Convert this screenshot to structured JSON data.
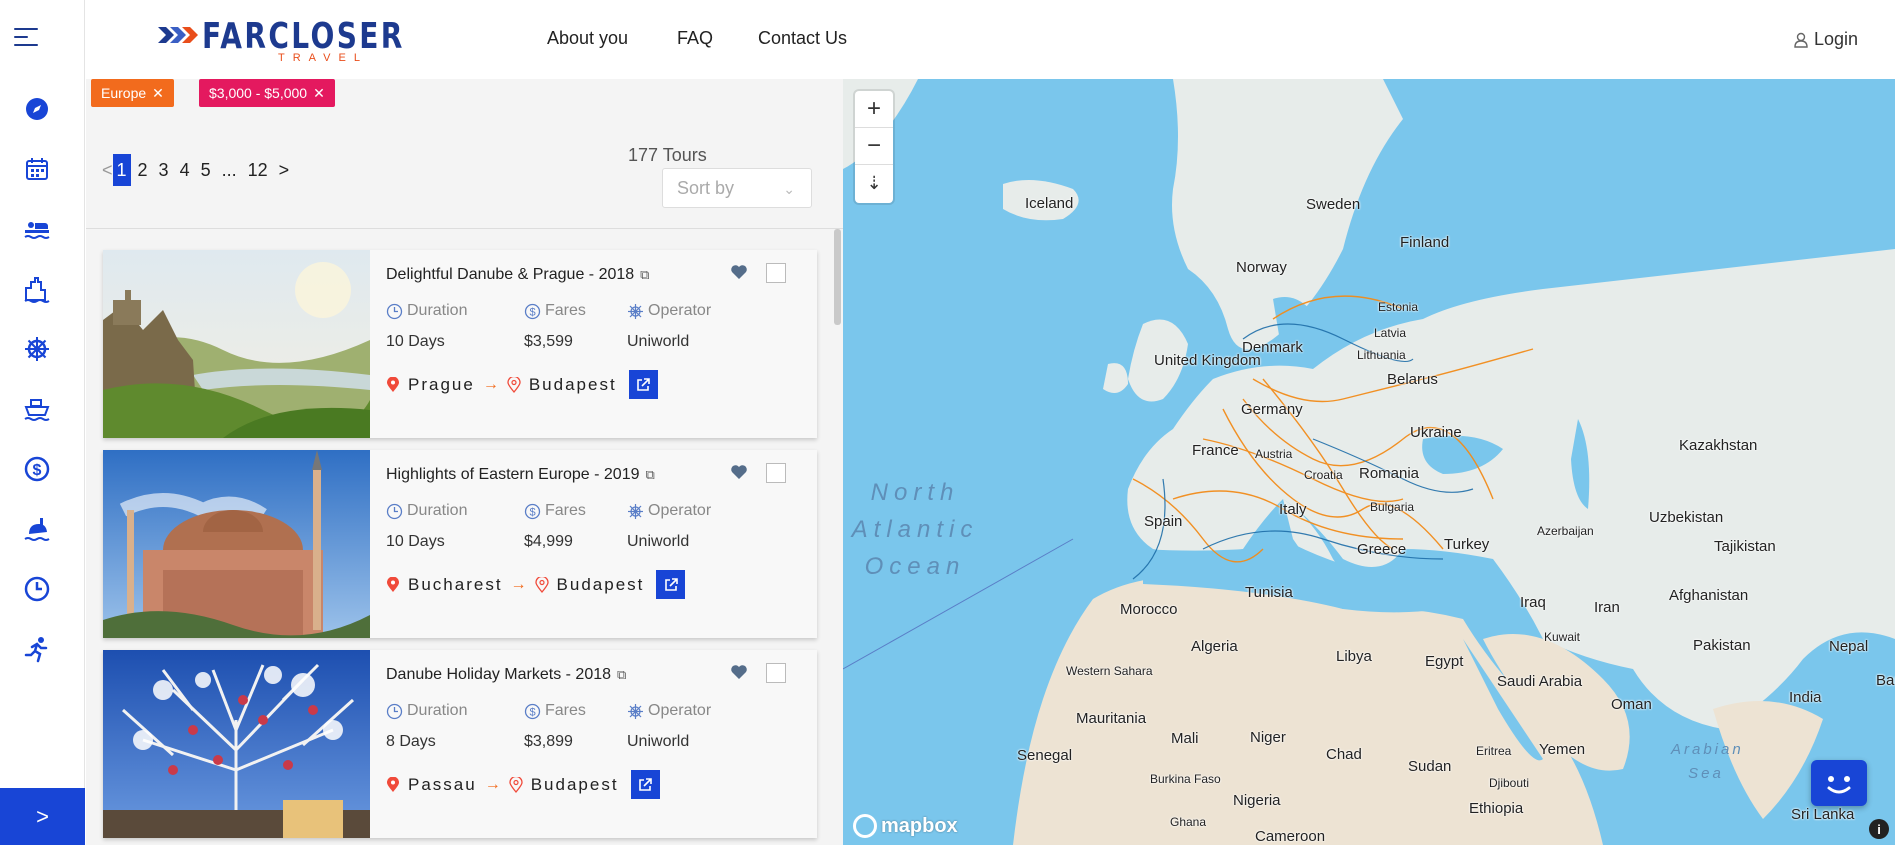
{
  "brand": {
    "name": "FARCLOSER",
    "sub": "TRAVEL"
  },
  "nav": {
    "about": "About you",
    "faq": "FAQ",
    "contact": "Contact Us",
    "login": "Login"
  },
  "rail": {
    "icons": [
      "compass-icon",
      "calendar-icon",
      "hotel-bed-icon",
      "city-icon",
      "ship-wheel-icon",
      "cruise-ship-icon",
      "dollar-icon",
      "snorkel-icon",
      "clock-icon",
      "runner-icon"
    ],
    "expand": ">"
  },
  "filters": [
    {
      "label": "Europe",
      "remove": "✕",
      "color": "#f26b1d"
    },
    {
      "label": "$3,000 - $5,000",
      "remove": "✕",
      "color": "#e4195f"
    }
  ],
  "pagination": {
    "prev": "<",
    "pages": [
      "1",
      "2",
      "3",
      "4",
      "5",
      "...",
      "12"
    ],
    "next": ">",
    "current": "1"
  },
  "results": {
    "count": "177 Tours",
    "sort_placeholder": "Sort by"
  },
  "meta_labels": {
    "duration": "Duration",
    "fares": "Fares",
    "operator": "Operator"
  },
  "tours": [
    {
      "title": "Delightful Danube & Prague - 2018",
      "duration": "10 Days",
      "fare": "$3,599",
      "operator": "Uniworld",
      "from": "Prague",
      "to": "Budapest"
    },
    {
      "title": "Highlights of Eastern Europe - 2019",
      "duration": "10 Days",
      "fare": "$4,999",
      "operator": "Uniworld",
      "from": "Bucharest",
      "to": "Budapest"
    },
    {
      "title": "Danube Holiday Markets - 2018",
      "duration": "8 Days",
      "fare": "$3,899",
      "operator": "Uniworld",
      "from": "Passau",
      "to": "Budapest"
    }
  ],
  "map": {
    "zoom_in": "+",
    "zoom_out": "−",
    "reset": "⇣",
    "attribution": "mapbox",
    "info": "i",
    "countries": [
      "Iceland",
      "Sweden",
      "Finland",
      "Norway",
      "Estonia",
      "Latvia",
      "Lithuania",
      "Denmark",
      "United Kingdom",
      "Belarus",
      "Germany",
      "Ukraine",
      "France",
      "Austria",
      "Romania",
      "Kazakhstan",
      "Croatia",
      "Bulgaria",
      "Uzbekistan",
      "Spain",
      "Italy",
      "Azerbaijan",
      "Turkey",
      "Tajikistan",
      "Greece",
      "Tunisia",
      "Morocco",
      "Iraq",
      "Iran",
      "Afghanistan",
      "Algeria",
      "Libya",
      "Egypt",
      "Kuwait",
      "Pakistan",
      "Nepal",
      "Western Sahara",
      "Saudi Arabia",
      "Oman",
      "India",
      "Bangl",
      "Mauritania",
      "Mali",
      "Niger",
      "Chad",
      "Sudan",
      "Eritrea",
      "Yemen",
      "Senegal",
      "Burkina Faso",
      "Djibouti",
      "Nigeria",
      "Ethiopia",
      "Ghana",
      "Cameroon",
      "Sri Lanka"
    ],
    "oceans": {
      "north_atlantic": "North Atlantic Ocean",
      "arabian_sea": "Arabian Sea"
    }
  }
}
